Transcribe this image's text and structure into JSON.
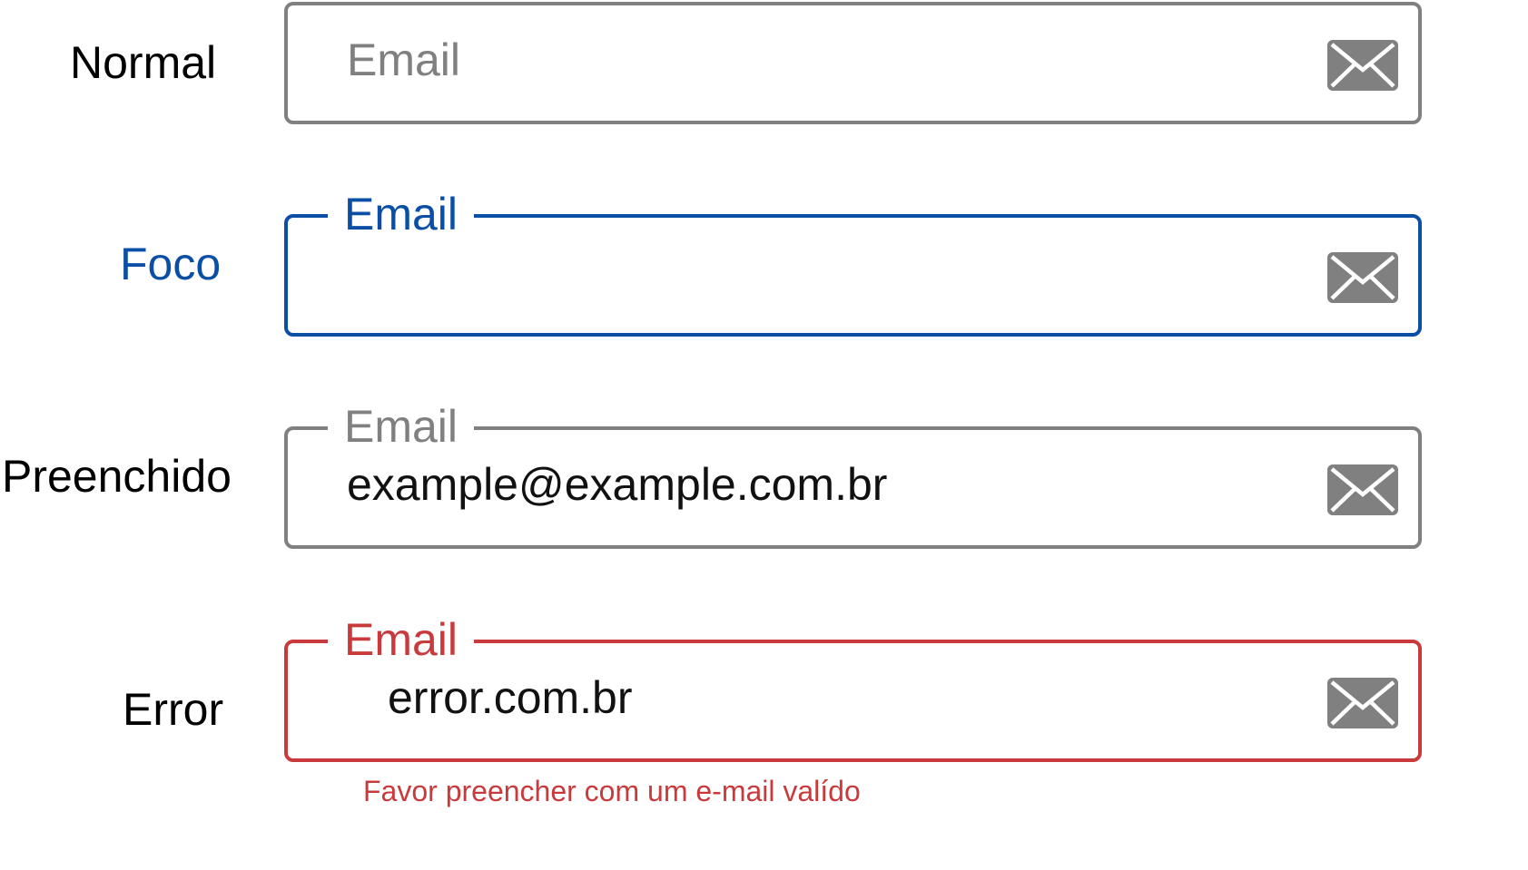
{
  "colors": {
    "neutral": "#808080",
    "focus": "#0a4ea5",
    "error": "#c93a3d",
    "text": "#111111",
    "label": "#000000"
  },
  "states": {
    "normal": {
      "label": "Normal",
      "placeholder": "Email",
      "icon": "mail-icon"
    },
    "focus": {
      "label": "Foco",
      "field_label": "Email",
      "icon": "mail-icon"
    },
    "filled": {
      "label": "Preenchido",
      "field_label": "Email",
      "value": "example@example.com.br",
      "icon": "mail-icon"
    },
    "error": {
      "label": "Error",
      "field_label": "Email",
      "value": "error.com.br",
      "helper": "Favor preencher com um e-mail valído",
      "icon": "mail-icon"
    }
  }
}
